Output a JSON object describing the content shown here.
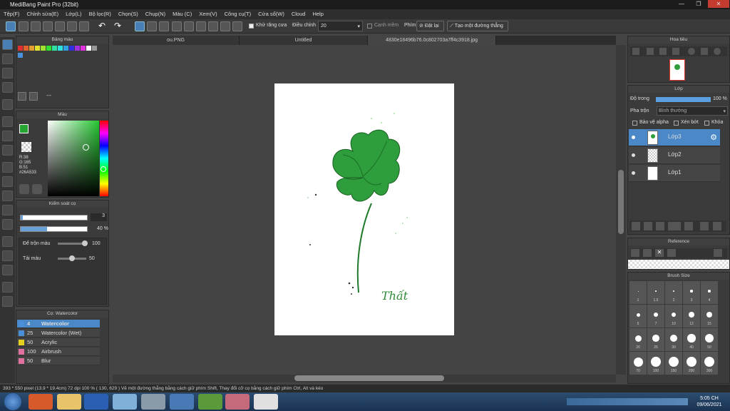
{
  "title": "MediBang Paint Pro (32bit)",
  "menu": [
    "Tệp(F)",
    "Chỉnh sửa(E)",
    "Lớp(L)",
    "Bộ lọc(R)",
    "Chọn(S)",
    "Chụp(N)",
    "Màu (C)",
    "Xem(V)",
    "Công cụ(T)",
    "Cửa sổ(W)",
    "Cloud",
    "Help"
  ],
  "toolbar": {
    "antialias": "Khử răng cưa",
    "correction_label": "Điều chỉnh",
    "correction_value": "20",
    "soft_edge": "Cạnh mềm",
    "key_label": "Phím",
    "reset": "Đặt lại",
    "straight_line": "Tạo một đường thẳng"
  },
  "panels": {
    "palette": "Bảng màu",
    "color": "Màu",
    "brush_control": "Kiểm soát cọ",
    "brush": "Cọ: Watercolor",
    "navigator": "Hoa tiêu",
    "layer": "Lớp",
    "reference": "Reference",
    "brush_size": "Brush Size"
  },
  "palette_dash": "---",
  "color": {
    "r": "R:38",
    "g": "G:165",
    "b": "B:51",
    "hex": "#26A533",
    "accent": "#26A533"
  },
  "brush_control": {
    "size": "3",
    "opacity": "40 %",
    "blend_label": "Để trộn màu",
    "blend_value": "100",
    "refill_label": "Tải màu",
    "refill_value": "50"
  },
  "tabs": [
    "ou.PNG",
    "Untitled",
    "4830e18496b76.0c802703a7ff4c3918.jpg"
  ],
  "layer_panel": {
    "opacity_label": "Độ trong",
    "opacity_value": "100 %",
    "blend_label": "Pha trộn",
    "blend_value": "Bình thường",
    "protect_alpha": "Bảo vệ alpha",
    "clip": "Xén bớt",
    "lock": "Khóa"
  },
  "layers": [
    {
      "name": "Lớp3"
    },
    {
      "name": "Lớp2"
    },
    {
      "name": "Lớp1"
    }
  ],
  "brushes": [
    {
      "size": "4",
      "name": "Watercolor",
      "color": "#4a90d9"
    },
    {
      "size": "25",
      "name": "Watercolor (Wet)",
      "color": "#4a90d9"
    },
    {
      "size": "50",
      "name": "Acrylic",
      "color": "#e8d020"
    },
    {
      "size": "100",
      "name": "Airbrush",
      "color": "#e070a0"
    },
    {
      "size": "50",
      "name": "Blur",
      "color": "#e070a0"
    }
  ],
  "brush_sizes": [
    "1",
    "1.5",
    "2",
    "3",
    "4",
    "5",
    "7",
    "10",
    "12",
    "15",
    "20",
    "25",
    "30",
    "40",
    "50",
    "70",
    "100",
    "150",
    "200",
    "300"
  ],
  "signature": "Thất",
  "status": "393 * 550 pixel   (13.9 * 19.4cm)   72 dpi   100 %   ( 130, 629 )   Vẽ một đường thẳng bằng cách giữ phím Shift, Thay đổi cỡ cọ bằng cách giữ phím Ctrl, Alt và kéo",
  "clock": {
    "time": "5:05 CH",
    "date": "09/06/2021"
  }
}
